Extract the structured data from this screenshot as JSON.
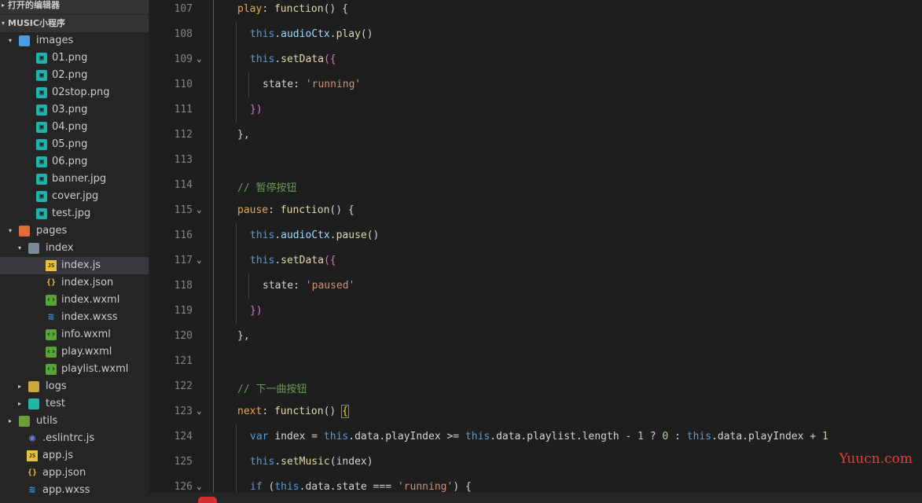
{
  "sidebar": {
    "open_editors_label": "打开的编辑器",
    "project_label": "MUSIC小程序",
    "tree": [
      {
        "label": "images",
        "kind": "folder-img",
        "depth": 0,
        "expanded": true
      },
      {
        "label": "01.png",
        "kind": "img",
        "depth": 1
      },
      {
        "label": "02.png",
        "kind": "img",
        "depth": 1
      },
      {
        "label": "02stop.png",
        "kind": "img",
        "depth": 1
      },
      {
        "label": "03.png",
        "kind": "img",
        "depth": 1
      },
      {
        "label": "04.png",
        "kind": "img",
        "depth": 1
      },
      {
        "label": "05.png",
        "kind": "img",
        "depth": 1
      },
      {
        "label": "06.png",
        "kind": "img",
        "depth": 1
      },
      {
        "label": "banner.jpg",
        "kind": "img",
        "depth": 1
      },
      {
        "label": "cover.jpg",
        "kind": "img",
        "depth": 1
      },
      {
        "label": "test.jpg",
        "kind": "img",
        "depth": 1
      },
      {
        "label": "pages",
        "kind": "folder-pages",
        "depth": 0,
        "expanded": true
      },
      {
        "label": "index",
        "kind": "folder-plain",
        "depth": 1,
        "expanded": true
      },
      {
        "label": "index.js",
        "kind": "js",
        "depth": 2,
        "selected": true
      },
      {
        "label": "index.json",
        "kind": "json",
        "depth": 2
      },
      {
        "label": "index.wxml",
        "kind": "wxml",
        "depth": 2
      },
      {
        "label": "index.wxss",
        "kind": "css",
        "depth": 2
      },
      {
        "label": "info.wxml",
        "kind": "wxml",
        "depth": 2
      },
      {
        "label": "play.wxml",
        "kind": "wxml",
        "depth": 2
      },
      {
        "label": "playlist.wxml",
        "kind": "wxml",
        "depth": 2
      },
      {
        "label": "logs",
        "kind": "folder-logs",
        "depth": 1,
        "expanded": false
      },
      {
        "label": "test",
        "kind": "folder-test",
        "depth": 1,
        "expanded": false
      },
      {
        "label": "utils",
        "kind": "folder-utils",
        "depth": 0,
        "expanded": false
      },
      {
        "label": ".eslintrc.js",
        "kind": "eslint",
        "depth": 0
      },
      {
        "label": "app.js",
        "kind": "js",
        "depth": 0
      },
      {
        "label": "app.json",
        "kind": "json",
        "depth": 0
      },
      {
        "label": "app.wxss",
        "kind": "css",
        "depth": 0
      }
    ]
  },
  "editor": {
    "lines": [
      {
        "num": "107",
        "indent": 0,
        "fold": false,
        "tokens": [
          [
            "fnkey",
            "play"
          ],
          [
            "op",
            ": "
          ],
          [
            "fn",
            "function"
          ],
          [
            "op",
            "() {"
          ]
        ]
      },
      {
        "num": "108",
        "indent": 1,
        "fold": false,
        "tokens": [
          [
            "kw",
            "this"
          ],
          [
            "op",
            "."
          ],
          [
            "prop",
            "audioCtx"
          ],
          [
            "op",
            "."
          ],
          [
            "fn",
            "play"
          ],
          [
            "op",
            "()"
          ]
        ]
      },
      {
        "num": "109",
        "indent": 1,
        "fold": true,
        "tokens": [
          [
            "kw",
            "this"
          ],
          [
            "op",
            "."
          ],
          [
            "fn",
            "setData"
          ],
          [
            "brk",
            "({"
          ]
        ]
      },
      {
        "num": "110",
        "indent": 2,
        "fold": false,
        "tokens": [
          [
            "op",
            "state: "
          ],
          [
            "str",
            "'running'"
          ]
        ]
      },
      {
        "num": "111",
        "indent": 1,
        "fold": false,
        "tokens": [
          [
            "brk",
            "})"
          ]
        ]
      },
      {
        "num": "112",
        "indent": 0,
        "fold": false,
        "tokens": [
          [
            "op",
            "},"
          ]
        ]
      },
      {
        "num": "113",
        "indent": 0,
        "fold": false,
        "tokens": []
      },
      {
        "num": "114",
        "indent": 0,
        "fold": false,
        "tokens": [
          [
            "cm",
            "// 暂停按钮"
          ]
        ]
      },
      {
        "num": "115",
        "indent": 0,
        "fold": true,
        "tokens": [
          [
            "fnkey",
            "pause"
          ],
          [
            "op",
            ": "
          ],
          [
            "fn",
            "function"
          ],
          [
            "op",
            "() {"
          ]
        ]
      },
      {
        "num": "116",
        "indent": 1,
        "fold": false,
        "tokens": [
          [
            "kw",
            "this"
          ],
          [
            "op",
            "."
          ],
          [
            "prop",
            "audioCtx"
          ],
          [
            "op",
            "."
          ],
          [
            "fn",
            "pause"
          ],
          [
            "op",
            "()"
          ]
        ]
      },
      {
        "num": "117",
        "indent": 1,
        "fold": true,
        "tokens": [
          [
            "kw",
            "this"
          ],
          [
            "op",
            "."
          ],
          [
            "fn",
            "setData"
          ],
          [
            "brk",
            "({"
          ]
        ]
      },
      {
        "num": "118",
        "indent": 2,
        "fold": false,
        "tokens": [
          [
            "op",
            "state: "
          ],
          [
            "str",
            "'paused'"
          ]
        ]
      },
      {
        "num": "119",
        "indent": 1,
        "fold": false,
        "tokens": [
          [
            "brk",
            "})"
          ]
        ]
      },
      {
        "num": "120",
        "indent": 0,
        "fold": false,
        "tokens": [
          [
            "op",
            "},"
          ]
        ]
      },
      {
        "num": "121",
        "indent": 0,
        "fold": false,
        "tokens": []
      },
      {
        "num": "122",
        "indent": 0,
        "fold": false,
        "tokens": [
          [
            "cm",
            "// 下一曲按钮"
          ]
        ]
      },
      {
        "num": "123",
        "indent": 0,
        "fold": true,
        "tokens": [
          [
            "fnkey",
            "next"
          ],
          [
            "op",
            ": "
          ],
          [
            "fn",
            "function"
          ],
          [
            "op",
            "() "
          ],
          [
            "brk2",
            "{"
          ]
        ]
      },
      {
        "num": "124",
        "indent": 1,
        "fold": false,
        "tokens": [
          [
            "kw",
            "var "
          ],
          [
            "op",
            "index "
          ],
          [
            "op",
            "= "
          ],
          [
            "kw",
            "this"
          ],
          [
            "op",
            ".data.playIndex "
          ],
          [
            "op",
            ">= "
          ],
          [
            "kw",
            "this"
          ],
          [
            "op",
            ".data.playlist.length "
          ],
          [
            "op",
            "- "
          ],
          [
            "num",
            "1 "
          ],
          [
            "op",
            "? "
          ],
          [
            "num",
            "0 "
          ],
          [
            "op",
            ": "
          ],
          [
            "kw",
            "this"
          ],
          [
            "op",
            ".data.playIndex "
          ],
          [
            "op",
            "+ "
          ],
          [
            "num",
            "1"
          ]
        ]
      },
      {
        "num": "125",
        "indent": 1,
        "fold": false,
        "tokens": [
          [
            "kw",
            "this"
          ],
          [
            "op",
            "."
          ],
          [
            "fn",
            "setMusic"
          ],
          [
            "op",
            "(index)"
          ]
        ]
      },
      {
        "num": "126",
        "indent": 1,
        "fold": true,
        "tokens": [
          [
            "kw",
            "if "
          ],
          [
            "op",
            "("
          ],
          [
            "kw",
            "this"
          ],
          [
            "op",
            ".data.state "
          ],
          [
            "op",
            "=== "
          ],
          [
            "str",
            "'running'"
          ],
          [
            "op",
            ") {"
          ]
        ]
      }
    ]
  },
  "watermark": "Yuucn.com"
}
